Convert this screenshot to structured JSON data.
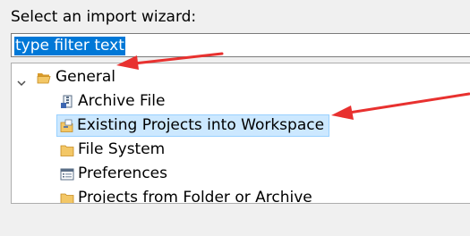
{
  "dialog": {
    "prompt": "Select an import wizard:",
    "filter": {
      "value": "type filter text"
    }
  },
  "tree": {
    "expand_icon": "chevron-down-icon",
    "root": {
      "label": "General",
      "icon": "open-folder-icon",
      "expanded": true
    },
    "children": [
      {
        "label": "Archive File",
        "icon": "archive-file-icon"
      },
      {
        "label": "Existing Projects into Workspace",
        "icon": "existing-projects-icon",
        "selected": true
      },
      {
        "label": "File System",
        "icon": "folder-icon"
      },
      {
        "label": "Preferences",
        "icon": "preferences-icon"
      },
      {
        "label": "Projects from Folder or Archive",
        "icon": "folder-icon"
      }
    ]
  },
  "colors": {
    "selection_highlight": "#0078d7",
    "tree_selection_bg": "#cce8ff",
    "annotation_arrow": "#e8312f"
  }
}
